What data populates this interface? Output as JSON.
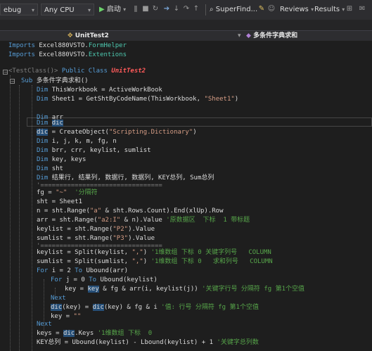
{
  "toolbar": {
    "config": "ebug",
    "platform": "Any CPU",
    "start_label": "启动",
    "superfind_label": "SuperFind...",
    "reviews_label": "Reviews",
    "results_label": "Results"
  },
  "navbar": {
    "class_name": "UnitTest2",
    "method_name": "多条件字典求和"
  },
  "code": {
    "lines": [
      {
        "segs": [
          [
            "kw",
            "Imports "
          ],
          [
            "",
            "Excel880VSTO."
          ],
          [
            "tp",
            "FormHelper"
          ]
        ]
      },
      {
        "segs": [
          [
            "kw",
            "Imports "
          ],
          [
            "",
            "Excel880VSTO."
          ],
          [
            "tp",
            "Extentions"
          ]
        ]
      },
      {
        "segs": [
          [
            "",
            ""
          ]
        ]
      },
      {
        "segs": [
          [
            "gy",
            "<TestClass()> "
          ],
          [
            "kw",
            "Public Class "
          ],
          [
            "fn",
            "UnitTest2"
          ]
        ]
      },
      {
        "segs": [
          [
            "kw",
            "Sub "
          ],
          [
            "",
            "多条件字典求和()"
          ]
        ]
      },
      {
        "segs": [
          [
            "kw",
            "Dim "
          ],
          [
            "",
            "ThisWorkbook = ActiveWorkBook"
          ]
        ]
      },
      {
        "segs": [
          [
            "kw",
            "Dim "
          ],
          [
            "",
            "Sheet1 = GetShtByCodeName(ThisWorkbook, "
          ],
          [
            "st",
            "\"Sheet1\""
          ],
          [
            "",
            ")"
          ]
        ]
      },
      {
        "segs": [
          [
            "",
            ""
          ]
        ]
      },
      {
        "segs": [
          [
            "kw",
            "Dim "
          ],
          [
            "",
            "arr"
          ]
        ]
      },
      {
        "segs": [
          [
            "kw",
            "Dim "
          ],
          [
            "hl",
            "dic"
          ]
        ]
      },
      {
        "segs": [
          [
            "hl",
            "dic"
          ],
          [
            "",
            " = CreateObject("
          ],
          [
            "st",
            "\"Scripting.Dictionary\""
          ],
          [
            "",
            ")"
          ]
        ]
      },
      {
        "segs": [
          [
            "kw",
            "Dim "
          ],
          [
            "",
            "i, j, k, m, fg, n"
          ]
        ]
      },
      {
        "segs": [
          [
            "kw",
            "Dim "
          ],
          [
            "",
            "brr, crr, keylist, sumlist"
          ]
        ]
      },
      {
        "segs": [
          [
            "kw",
            "Dim "
          ],
          [
            "",
            "key, keys"
          ]
        ]
      },
      {
        "segs": [
          [
            "kw",
            "Dim "
          ],
          [
            "",
            "sht"
          ]
        ]
      },
      {
        "segs": [
          [
            "kw",
            "Dim "
          ],
          [
            "",
            "结果行, 结果列, 数据行, 数据列, KEY总列, Sum总列"
          ]
        ]
      },
      {
        "segs": [
          [
            "gy",
            "'================================"
          ]
        ]
      },
      {
        "segs": [
          [
            "",
            "fg = "
          ],
          [
            "st",
            "\"~\""
          ],
          [
            "cm",
            "  '分隔符"
          ]
        ]
      },
      {
        "segs": [
          [
            "",
            "sht = Sheet1"
          ]
        ]
      },
      {
        "segs": [
          [
            "",
            "n = sht.Range("
          ],
          [
            "st",
            "\"a\""
          ],
          [
            "",
            " & sht.Rows.Count).End(xlUp).Row"
          ]
        ]
      },
      {
        "segs": [
          [
            "",
            "arr = sht.Range("
          ],
          [
            "st",
            "\"a2:I\""
          ],
          [
            "",
            " & n).Value "
          ],
          [
            "cm",
            "'原数据区  下标  1 带标题"
          ]
        ]
      },
      {
        "segs": [
          [
            "",
            "keylist = sht.Range("
          ],
          [
            "st",
            "\"P2\""
          ],
          [
            "",
            ").Value"
          ]
        ]
      },
      {
        "segs": [
          [
            "",
            "sumlist = sht.Range("
          ],
          [
            "st",
            "\"P3\""
          ],
          [
            "",
            ").Value"
          ]
        ]
      },
      {
        "segs": [
          [
            "gy",
            "'================================"
          ]
        ]
      },
      {
        "segs": [
          [
            "",
            "keylist = Split(keylist, "
          ],
          [
            "st",
            "\",\""
          ],
          [
            "",
            ") "
          ],
          [
            "cm",
            "'1维数组 下标 0 关键字列号   COLUMN"
          ]
        ]
      },
      {
        "segs": [
          [
            "",
            "sumlist = Split(sumlist, "
          ],
          [
            "st",
            "\",\""
          ],
          [
            "",
            ") "
          ],
          [
            "cm",
            "'1维数组 下标 0   求和列号   COLUMN"
          ]
        ]
      },
      {
        "segs": [
          [
            "kw",
            "For "
          ],
          [
            "",
            "i = 2 "
          ],
          [
            "kw",
            "To "
          ],
          [
            "",
            "Ubound(arr)"
          ]
        ]
      },
      {
        "segs": [
          [
            "kw",
            "For "
          ],
          [
            "",
            "j = 0 "
          ],
          [
            "kw",
            "To "
          ],
          [
            "",
            "Ubound(keylist)"
          ]
        ]
      },
      {
        "segs": [
          [
            "",
            "key = "
          ],
          [
            "hl",
            "key"
          ],
          [
            "",
            " & fg & arr(i, keylist(j)) "
          ],
          [
            "cm",
            "'关键字行号 分隔符 fg 第1个空值"
          ]
        ]
      },
      {
        "segs": [
          [
            "kw",
            "Next"
          ]
        ]
      },
      {
        "segs": [
          [
            "hl",
            "dic"
          ],
          [
            "",
            "(key) = "
          ],
          [
            "hl",
            "dic"
          ],
          [
            "",
            "(key) & fg & i "
          ],
          [
            "cm",
            "'值: 行号 分隔符 fg 第1个空值"
          ]
        ]
      },
      {
        "segs": [
          [
            "",
            "key = "
          ],
          [
            "st",
            "\"\""
          ]
        ]
      },
      {
        "segs": [
          [
            "kw",
            "Next"
          ]
        ]
      },
      {
        "segs": [
          [
            "",
            "keys = "
          ],
          [
            "hl",
            "dic"
          ],
          [
            "",
            ".Keys "
          ],
          [
            "cm",
            "'1维数组 下标  0"
          ]
        ]
      },
      {
        "segs": [
          [
            "",
            "KEY总列 = Ubound(keylist) - Lbound(keylist) + 1 "
          ],
          [
            "cm",
            "'关键字总列数"
          ]
        ]
      }
    ]
  }
}
